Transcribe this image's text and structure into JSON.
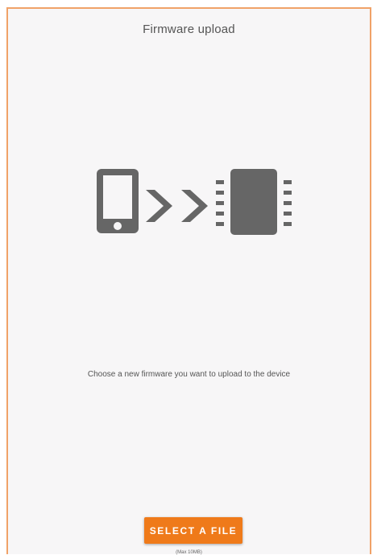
{
  "header": {
    "title": "Firmware upload"
  },
  "illustration": {
    "icons": [
      "phone-icon",
      "chevron-right-icon",
      "chevron-right-icon",
      "chip-icon"
    ],
    "color": "#666666"
  },
  "main": {
    "message": "Choose a new firmware you want to upload to the device"
  },
  "actions": {
    "select_file_label": "SELECT A FILE",
    "max_size_note": "(Max 10MB)"
  },
  "colors": {
    "accent": "#ef7a1a",
    "border": "#f0a268",
    "background": "#f7f6f7"
  }
}
